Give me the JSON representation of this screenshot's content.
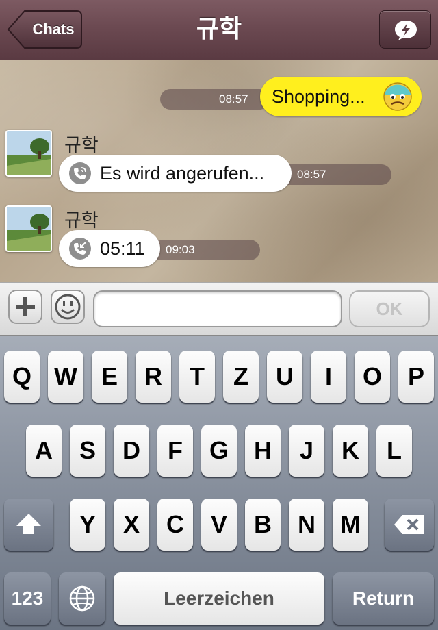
{
  "nav": {
    "back_label": "Chats",
    "title": "규학"
  },
  "messages": [
    {
      "type": "outgoing",
      "text": "Shopping...",
      "time": "08:57"
    },
    {
      "type": "incoming",
      "sender": "규학",
      "text": "Es wird angerufen...",
      "time": "08:57"
    },
    {
      "type": "incoming",
      "sender": "규학",
      "text": "05:11",
      "time": "09:03"
    }
  ],
  "input": {
    "placeholder": "",
    "ok_label": "OK"
  },
  "keyboard": {
    "row1": [
      "Q",
      "W",
      "E",
      "R",
      "T",
      "Z",
      "U",
      "I",
      "O",
      "P"
    ],
    "row2": [
      "A",
      "S",
      "D",
      "F",
      "G",
      "H",
      "J",
      "K",
      "L"
    ],
    "row3": [
      "Y",
      "X",
      "C",
      "V",
      "B",
      "N",
      "M"
    ],
    "numbers_label": "123",
    "space_label": "Leerzeichen",
    "return_label": "Return"
  },
  "colors": {
    "navbar": "#6a4850",
    "outgoing_bubble": "#ffef1e",
    "incoming_bubble": "#ffffff"
  }
}
